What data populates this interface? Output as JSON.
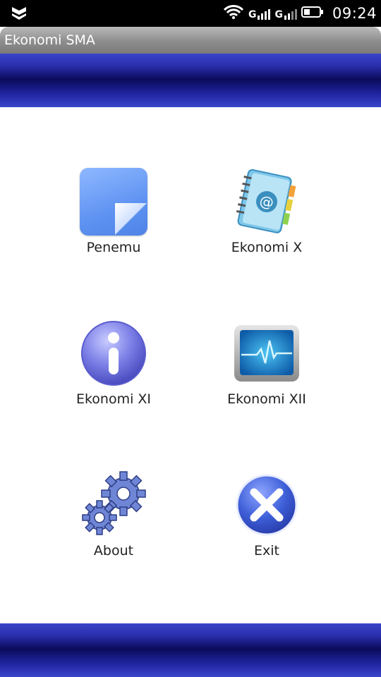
{
  "status_bar": {
    "time": "09:24",
    "icons": [
      "shield-icon",
      "wifi-icon",
      "signal-icon",
      "signal-icon",
      "battery-icon"
    ],
    "signal_labels": [
      "G",
      "G"
    ]
  },
  "app": {
    "title": "Ekonomi SMA"
  },
  "menu": {
    "items": [
      {
        "label": "Penemu",
        "icon": "note-icon"
      },
      {
        "label": "Ekonomi X",
        "icon": "address-book-icon"
      },
      {
        "label": "Ekonomi XI",
        "icon": "info-icon"
      },
      {
        "label": "Ekonomi XII",
        "icon": "monitor-pulse-icon"
      },
      {
        "label": "About",
        "icon": "gears-icon"
      },
      {
        "label": "Exit",
        "icon": "close-icon"
      }
    ]
  },
  "colors": {
    "header_blue": "#2a2fae",
    "header_dark": "#0b0b5c",
    "title_gray": "#8d8d8d",
    "icon_blue": "#5f93f2"
  }
}
